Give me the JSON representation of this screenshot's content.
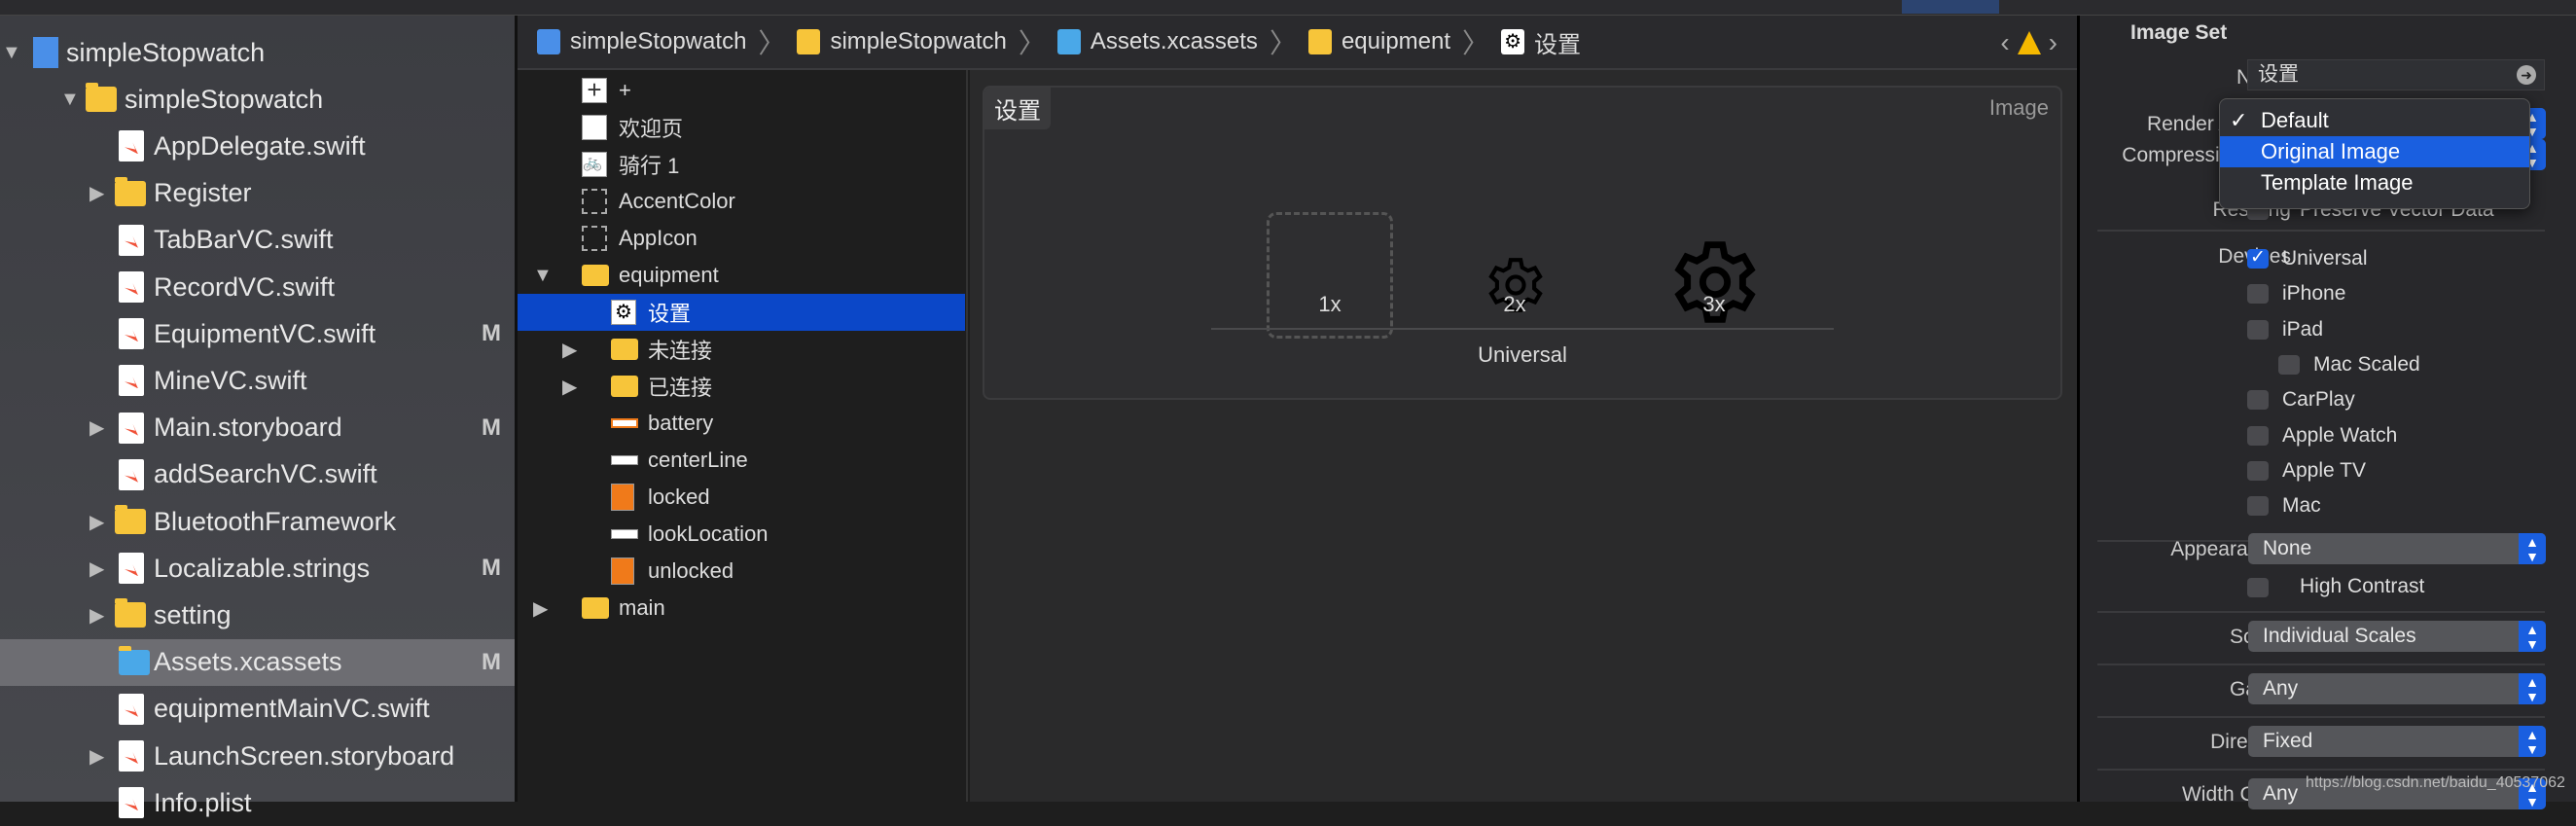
{
  "navigator": {
    "items": [
      {
        "label": "simpleStopwatch",
        "icon": "project-icon",
        "indent": 0,
        "disclosure": "open"
      },
      {
        "label": "simpleStopwatch",
        "icon": "folder-icon",
        "indent": 1,
        "disclosure": "open"
      },
      {
        "label": "AppDelegate.swift",
        "icon": "swift-file-icon",
        "indent": 2
      },
      {
        "label": "Register",
        "icon": "folder-icon",
        "indent": 2,
        "disclosure": "closed"
      },
      {
        "label": "TabBarVC.swift",
        "icon": "swift-file-icon",
        "indent": 2
      },
      {
        "label": "RecordVC.swift",
        "icon": "swift-file-icon",
        "indent": 2
      },
      {
        "label": "EquipmentVC.swift",
        "icon": "swift-file-icon",
        "indent": 2,
        "badge": "M"
      },
      {
        "label": "MineVC.swift",
        "icon": "swift-file-icon",
        "indent": 2
      },
      {
        "label": "Main.storyboard",
        "icon": "storyboard-icon",
        "indent": 2,
        "disclosure": "closed",
        "badge": "M"
      },
      {
        "label": "addSearchVC.swift",
        "icon": "swift-file-icon",
        "indent": 2
      },
      {
        "label": "BluetoothFramework",
        "icon": "folder-icon",
        "indent": 2,
        "disclosure": "closed"
      },
      {
        "label": "Localizable.strings",
        "icon": "strings-file-icon",
        "indent": 2,
        "disclosure": "closed",
        "badge": "M"
      },
      {
        "label": "setting",
        "icon": "folder-icon",
        "indent": 2,
        "disclosure": "closed"
      },
      {
        "label": "Assets.xcassets",
        "icon": "asset-catalog-icon",
        "indent": 2,
        "badge": "M",
        "selected": true
      },
      {
        "label": "equipmentMainVC.swift",
        "icon": "swift-file-icon",
        "indent": 2
      },
      {
        "label": "LaunchScreen.storyboard",
        "icon": "storyboard-icon",
        "indent": 2,
        "disclosure": "closed"
      },
      {
        "label": "Info.plist",
        "icon": "plist-icon",
        "indent": 2
      }
    ]
  },
  "breadcrumb": {
    "items": [
      {
        "label": "simpleStopwatch",
        "icon": "project-icon"
      },
      {
        "label": "simpleStopwatch",
        "icon": "folder-icon"
      },
      {
        "label": "Assets.xcassets",
        "icon": "asset-catalog-icon"
      },
      {
        "label": "equipment",
        "icon": "folder-icon"
      },
      {
        "label": "设置",
        "icon": "gear-icon"
      }
    ]
  },
  "assets": {
    "items": [
      {
        "label": "+",
        "icon": "image-icon",
        "indent": 0
      },
      {
        "label": "欢迎页",
        "icon": "image-icon",
        "indent": 0
      },
      {
        "label": "骑行 1",
        "icon": "bicycle-icon",
        "indent": 0
      },
      {
        "label": "AccentColor",
        "icon": "color-set-icon",
        "indent": 0
      },
      {
        "label": "AppIcon",
        "icon": "appicon-set-icon",
        "indent": 0
      },
      {
        "label": "equipment",
        "icon": "folder-icon",
        "indent": 0,
        "disclosure": "open"
      },
      {
        "label": "设置",
        "icon": "gear-icon",
        "indent": 1,
        "selected": true
      },
      {
        "label": "未连接",
        "icon": "folder-icon",
        "indent": 1,
        "disclosure": "closed"
      },
      {
        "label": "已连接",
        "icon": "folder-icon",
        "indent": 1,
        "disclosure": "closed"
      },
      {
        "label": "battery",
        "icon": "battery-icon",
        "indent": 1
      },
      {
        "label": "centerLine",
        "icon": "line-icon",
        "indent": 1
      },
      {
        "label": "locked",
        "icon": "lock-icon",
        "indent": 1
      },
      {
        "label": "lookLocation",
        "icon": "line-icon",
        "indent": 1
      },
      {
        "label": "unlocked",
        "icon": "unlock-icon",
        "indent": 1
      },
      {
        "label": "main",
        "icon": "folder-icon",
        "indent": 0,
        "disclosure": "closed"
      }
    ]
  },
  "editor": {
    "title": "设置",
    "type": "Image",
    "slots": [
      "1x",
      "2x",
      "3x"
    ],
    "group": "Universal"
  },
  "inspector": {
    "section": "Image Set",
    "name_label": "Name",
    "name_value": "设置",
    "render_label": "Render As",
    "compression_label": "Compression",
    "resizing_label": "Resizing",
    "resizing_value": "Preserve Vector Data",
    "devices_label": "Devices",
    "devices": [
      {
        "label": "Universal",
        "checked": true
      },
      {
        "label": "iPhone",
        "checked": false
      },
      {
        "label": "iPad",
        "checked": false
      },
      {
        "label": "Mac Scaled",
        "checked": false,
        "sub": true
      },
      {
        "label": "CarPlay",
        "checked": false
      },
      {
        "label": "Apple Watch",
        "checked": false
      },
      {
        "label": "Apple TV",
        "checked": false
      },
      {
        "label": "Mac",
        "checked": false
      }
    ],
    "appearances_label": "Appearances",
    "appearances_value": "None",
    "high_contrast": "High Contrast",
    "scales_label": "Scales",
    "scales_value": "Individual Scales",
    "gamut_label": "Gamut",
    "gamut_value": "Any",
    "direction_label": "Direction",
    "direction_value": "Fixed",
    "width_label": "Width Class",
    "width_value": "Any"
  },
  "render_menu": {
    "options": [
      {
        "label": "Default",
        "checked": true
      },
      {
        "label": "Original Image",
        "highlighted": true
      },
      {
        "label": "Template Image"
      }
    ]
  },
  "watermark": "https://blog.csdn.net/baidu_40537062",
  "colors": {
    "selection": "#0b47c8",
    "accent": "#1a5fe0",
    "folder": "#f7c53a",
    "warning": "#f5b800"
  }
}
